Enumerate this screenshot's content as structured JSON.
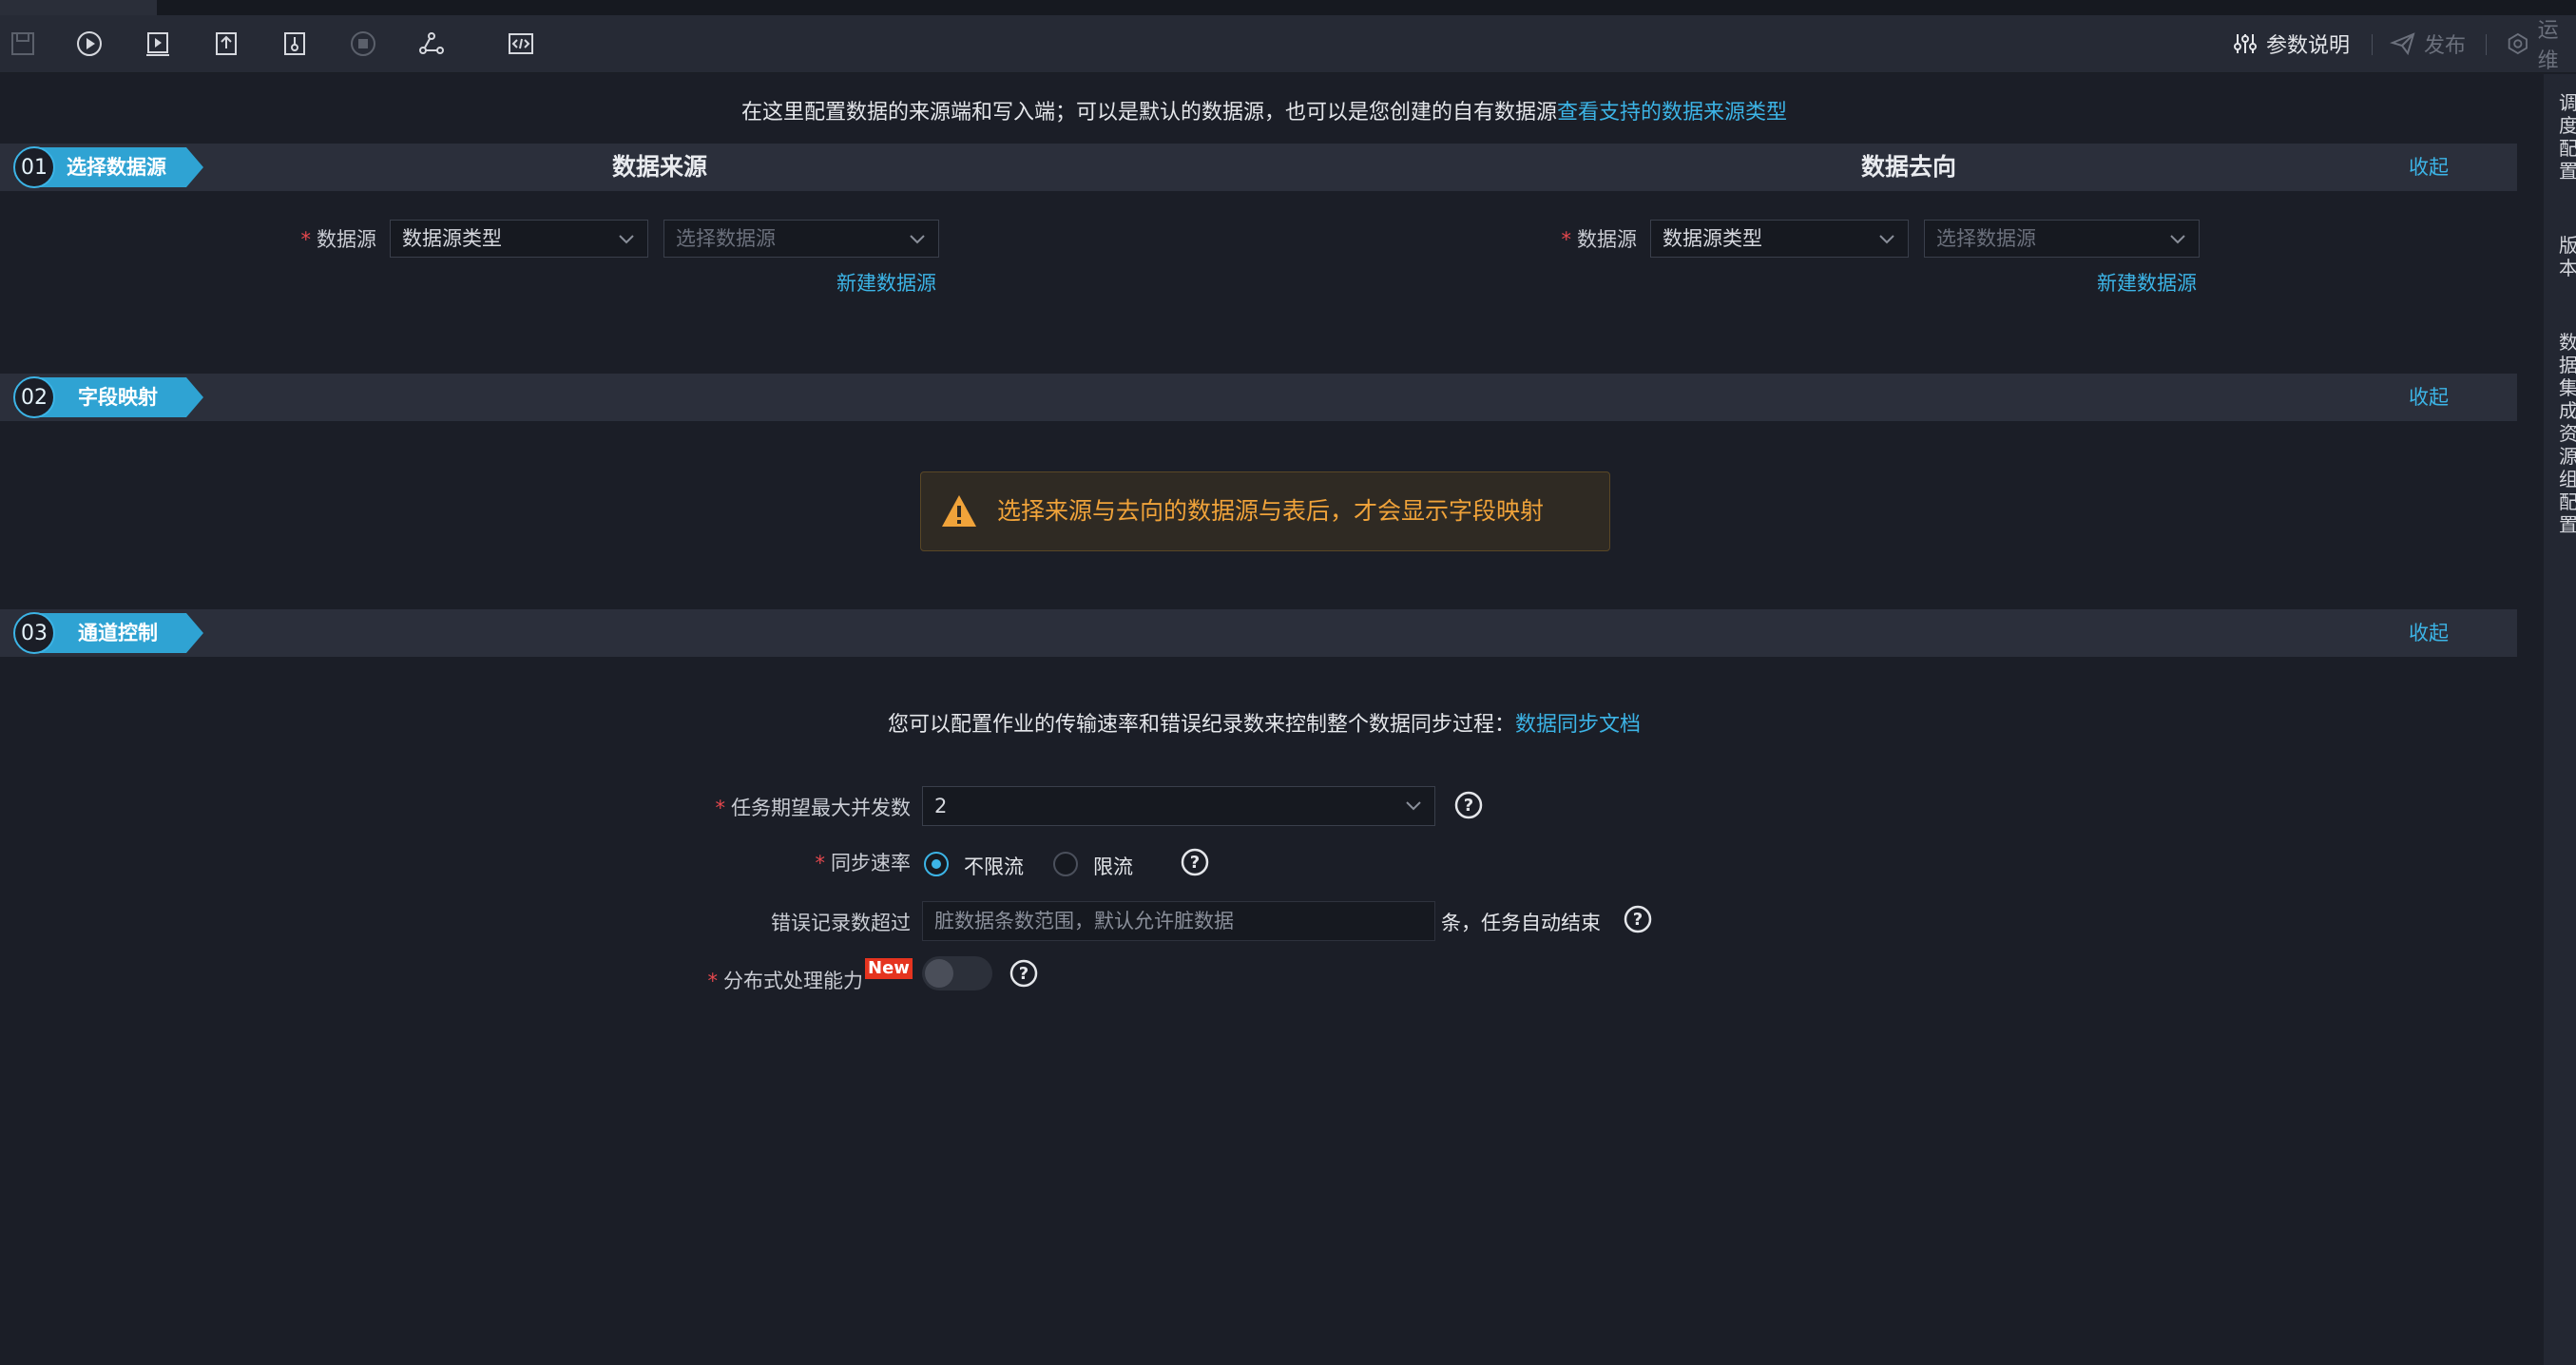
{
  "toolbar": {
    "icons": [
      "save-icon",
      "run-icon",
      "run-params-icon",
      "submit-icon",
      "version-icon",
      "stop-icon",
      "lineage-icon",
      "code-icon"
    ],
    "param_doc": "参数说明",
    "publish": "发布",
    "ops": "运维"
  },
  "rightbar": {
    "items": [
      "调度配置",
      "版本",
      "数据集成资源组配置"
    ]
  },
  "intro": {
    "text": "在这里配置数据的来源端和写入端；可以是默认的数据源，也可以是您创建的自有数据源",
    "link": "查看支持的数据来源类型"
  },
  "section1": {
    "num": "01",
    "label": "选择数据源",
    "collapse": "收起",
    "source": {
      "heading": "数据来源",
      "field_label": "数据源",
      "type_value": "数据源类型",
      "ds_placeholder": "选择数据源",
      "new_link": "新建数据源"
    },
    "target": {
      "heading": "数据去向",
      "field_label": "数据源",
      "type_value": "数据源类型",
      "ds_placeholder": "选择数据源",
      "new_link": "新建数据源"
    }
  },
  "section2": {
    "num": "02",
    "label": "字段映射",
    "collapse": "收起",
    "warning": "选择来源与去向的数据源与表后，才会显示字段映射"
  },
  "section3": {
    "num": "03",
    "label": "通道控制",
    "collapse": "收起",
    "desc": "您可以配置作业的传输速率和错误纪录数来控制整个数据同步过程：",
    "desc_link": "数据同步文档",
    "concurrency_label": "任务期望最大并发数",
    "concurrency_value": "2",
    "rate_label": "同步速率",
    "rate_options": [
      "不限流",
      "限流"
    ],
    "rate_selected": "不限流",
    "error_label": "错误记录数超过",
    "error_placeholder": "脏数据条数范围，默认允许脏数据",
    "error_suffix": "条，任务自动结束",
    "distributed_label": "分布式处理能力",
    "new_badge": "New",
    "distributed_enabled": false
  },
  "colors": {
    "accent": "#3cb4e6",
    "warning": "#f0a33a",
    "required": "#e5484d",
    "new_badge": "#e5341f"
  }
}
